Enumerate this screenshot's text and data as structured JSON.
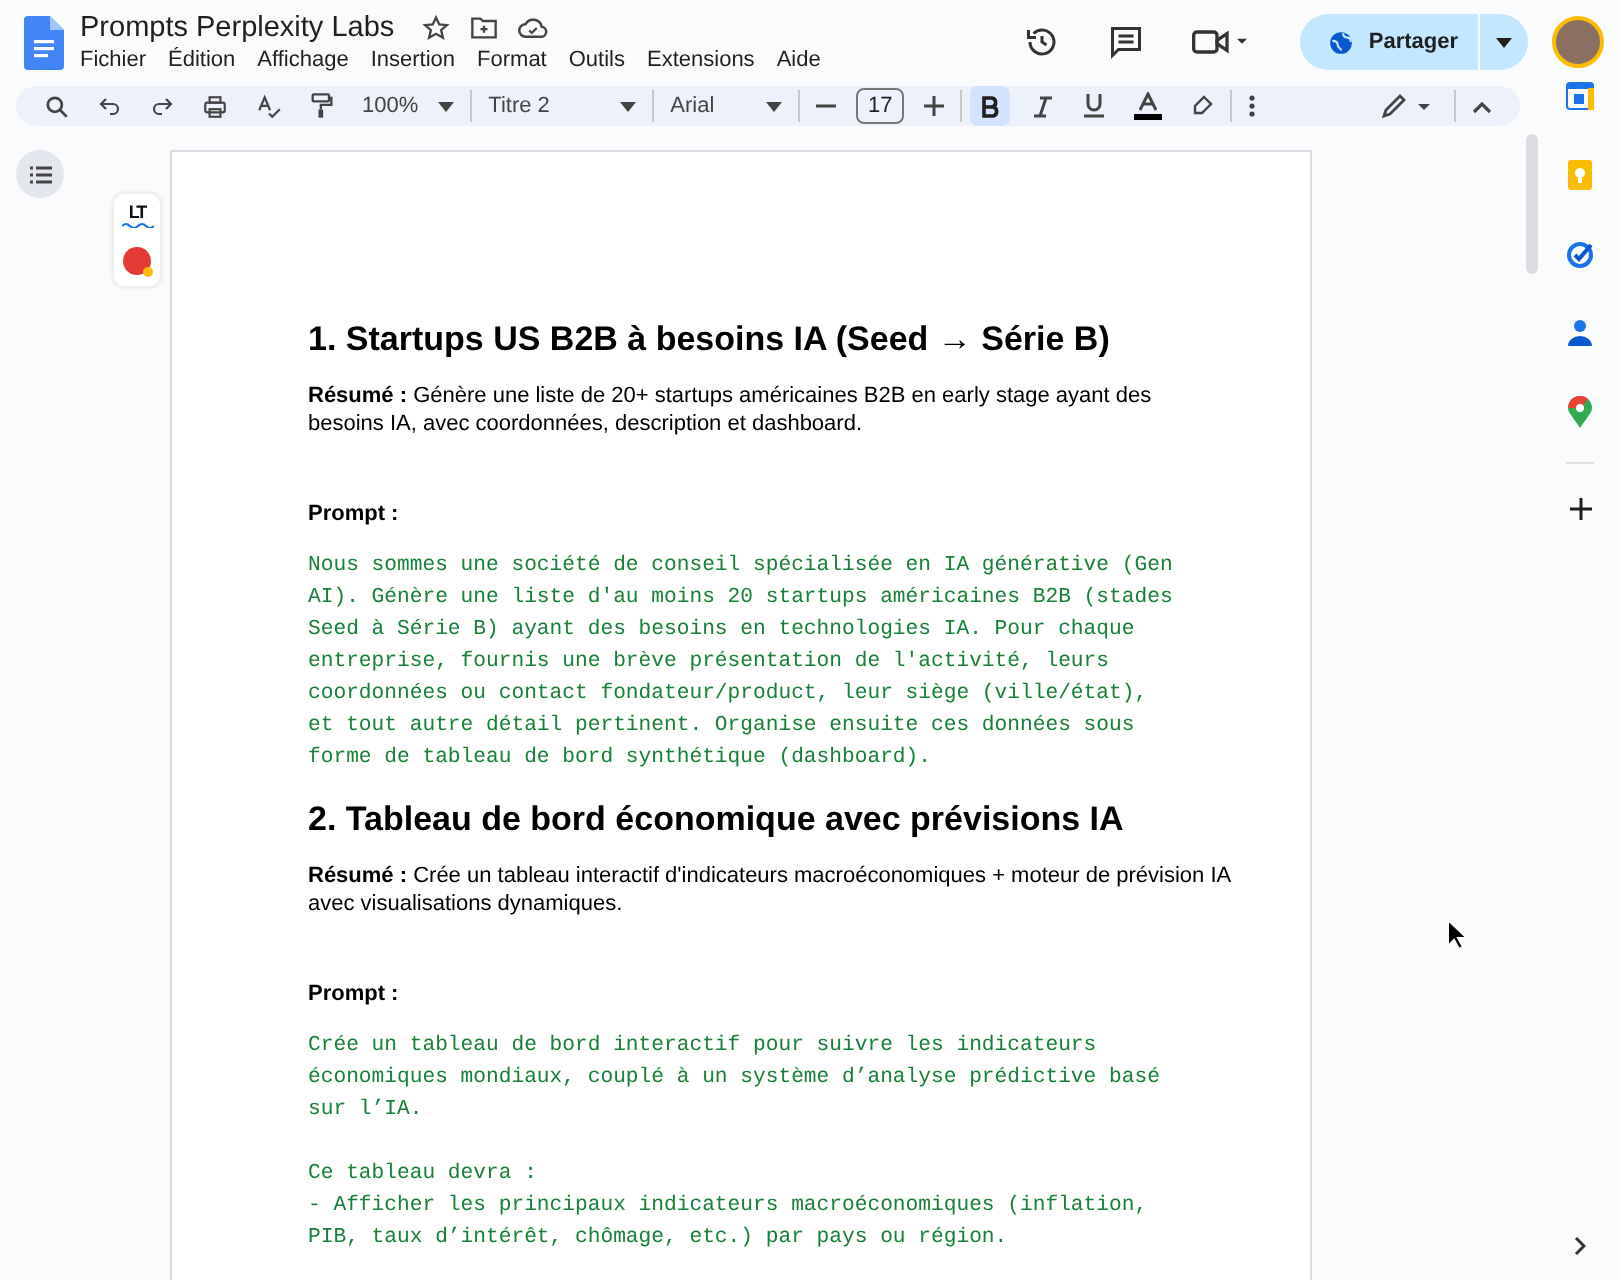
{
  "window": {
    "title": "Prompts Perplexity Labs"
  },
  "menus": [
    {
      "label": "Fichier"
    },
    {
      "label": "Édition"
    },
    {
      "label": "Affichage"
    },
    {
      "label": "Insertion"
    },
    {
      "label": "Format"
    },
    {
      "label": "Outils"
    },
    {
      "label": "Extensions"
    },
    {
      "label": "Aide"
    }
  ],
  "share_button": {
    "label": "Partager"
  },
  "toolbar": {
    "zoom": "100%",
    "style": "Titre 2",
    "font": "Arial",
    "font_size": "17",
    "bold": true,
    "italic": false,
    "underline": false
  },
  "extension_badge": {
    "label": "LT"
  },
  "sections": [
    {
      "heading": "1. Startups US B2B à besoins IA (Seed → Série B)",
      "summary": "**Résumé :** Génère une liste de 20+ startups américaines B2B en early stage ayant des besoins IA, avec coordonnées, description et dashboard.",
      "prompt_label": "Prompt :",
      "prompt": "Nous sommes une société de conseil spécialisée en IA générative (Gen\nAI). Génère une liste d'au moins 20 startups américaines B2B (stades\nSeed à Série B) ayant des besoins en technologies IA. Pour chaque\nentreprise, fournis une brève présentation de l'activité, leurs\ncoordonnées ou contact fondateur/product, leur siège (ville/état),\net tout autre détail pertinent. Organise ensuite ces données sous\nforme de tableau de bord synthétique (dashboard)."
    },
    {
      "heading": "2. Tableau de bord économique avec prévisions IA",
      "summary": "**Résumé :** Crée un tableau interactif d'indicateurs macroéconomiques + moteur de prévision IA avec visualisations dynamiques.",
      "prompt_label": "Prompt :",
      "prompt": "Crée un tableau de bord interactif pour suivre les indicateurs\néconomiques mondiaux, couplé à un système d’analyse prédictive basé\nsur l’IA.\n\nCe tableau devra :\n- Afficher les principaux indicateurs macroéconomiques (inflation,\nPIB, taux d’intérêt, chômage, etc.) par pays ou région."
    }
  ]
}
